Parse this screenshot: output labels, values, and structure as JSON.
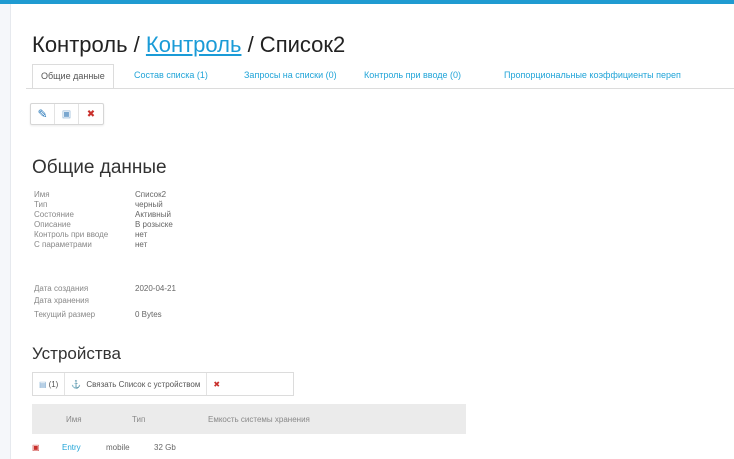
{
  "breadcrumb": {
    "part1": "Контроль / ",
    "link": "Контроль",
    "part3": " / Список2"
  },
  "tabs": [
    {
      "label": "Общие данные"
    },
    {
      "label": "Состав списка (1)"
    },
    {
      "label": "Запросы на списки (0)"
    },
    {
      "label": "Контроль при вводе (0)"
    },
    {
      "label": "Пропорциональные коэффициенты переп"
    }
  ],
  "toolbar": {
    "edit_icon": "✎",
    "save_icon": "▣",
    "delete_icon": "✖"
  },
  "general": {
    "heading": "Общие данные",
    "fields": [
      {
        "label": "Имя",
        "value": "Список2"
      },
      {
        "label": "Тип",
        "value": "черный"
      },
      {
        "label": "Состояние",
        "value": "Активный"
      },
      {
        "label": "Описание",
        "value": "В розыске"
      },
      {
        "label": "Контроль при вводе",
        "value": "нет"
      },
      {
        "label": "С параметрами",
        "value": "нет"
      },
      {
        "label": "Дата создания",
        "value": "2020-04-21"
      },
      {
        "label": "Дата хранения",
        "value": ""
      },
      {
        "label": "Текущий размер",
        "value": "0 Bytes"
      }
    ]
  },
  "devices": {
    "heading": "Устройства",
    "count_label": "(1)",
    "link_label": "Связать Список с устройством",
    "columns": [
      "Имя",
      "Тип",
      "Емкость системы хранения"
    ],
    "rows": [
      {
        "name": "Entry",
        "type": "mobile",
        "size": "32 Gb"
      }
    ]
  }
}
